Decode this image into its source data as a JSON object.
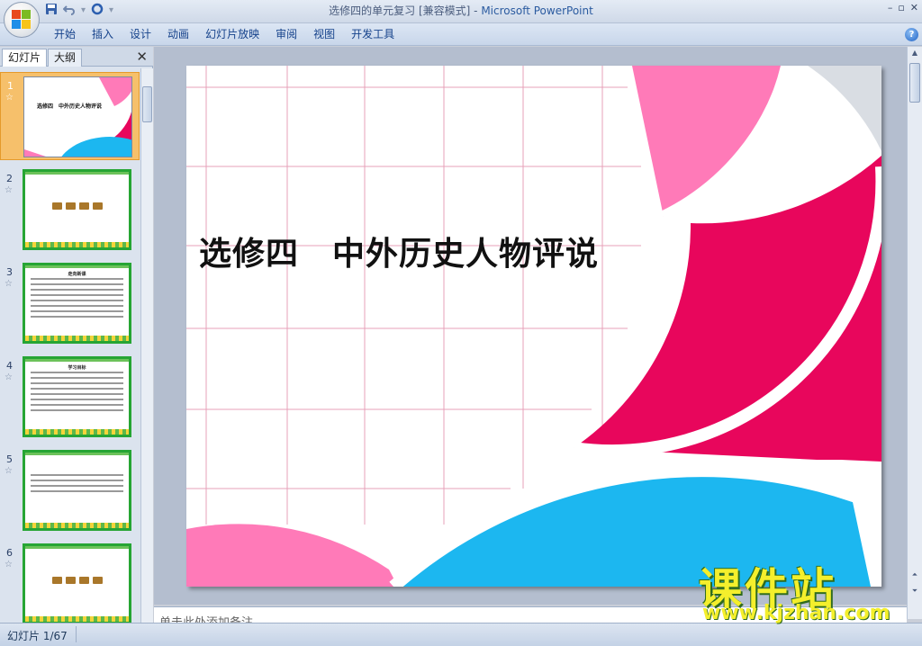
{
  "window": {
    "title": "选修四的单元复习 [兼容模式] - ",
    "app_name": "Microsoft PowerPoint",
    "controls": [
      "–",
      "▫",
      "✕"
    ]
  },
  "quick_access": {
    "save_icon": "save-icon",
    "undo_icon": "undo-icon",
    "redo_icon": "redo-icon",
    "customize_icon": "customize-icon"
  },
  "ribbon": {
    "tabs": [
      "开始",
      "插入",
      "设计",
      "动画",
      "幻灯片放映",
      "审阅",
      "视图",
      "开发工具"
    ],
    "help": "?"
  },
  "left_pane": {
    "tab_slides": "幻灯片",
    "tab_outline": "大纲",
    "close": "✕",
    "thumbnails": [
      {
        "number": "1",
        "title": "选修四　中外历史人物评说",
        "selected": true
      },
      {
        "number": "2"
      },
      {
        "number": "3",
        "title": "走向新课"
      },
      {
        "number": "4",
        "title": "学习目标"
      },
      {
        "number": "5"
      },
      {
        "number": "6"
      }
    ]
  },
  "slide": {
    "title": "选修四　中外历史人物评说",
    "colors": {
      "pink": "#e8065c",
      "light_pink": "#ff7ab8",
      "blue": "#1cb7f0",
      "gray": "#d9dde3",
      "grid": "#e7a1b9"
    }
  },
  "notes": {
    "placeholder": "单击此处添加备注"
  },
  "status": {
    "slide_count": "幻灯片 1/67"
  },
  "watermark": {
    "big": "课件站",
    "small": "www.kjzhan.com"
  }
}
